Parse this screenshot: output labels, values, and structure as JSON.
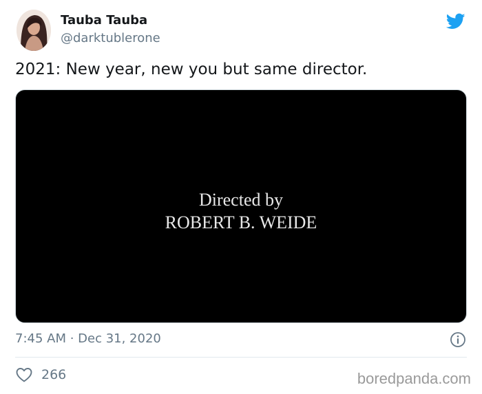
{
  "user": {
    "display_name": "Tauba Tauba",
    "handle": "@darktublerone",
    "avatar_icon": "profile-photo"
  },
  "tweet": {
    "text": "2021: New year, new you but same director."
  },
  "media": {
    "line1": "Directed by",
    "line2": "ROBERT B. WEIDE"
  },
  "footer": {
    "timestamp": "7:45 AM · Dec 31, 2020",
    "likes": "266",
    "info_icon": "info-icon",
    "like_icon": "heart-icon"
  },
  "brand": {
    "icon": "twitter-bird-icon",
    "color": "#1da1f2"
  },
  "watermark": "boredpanda.com"
}
